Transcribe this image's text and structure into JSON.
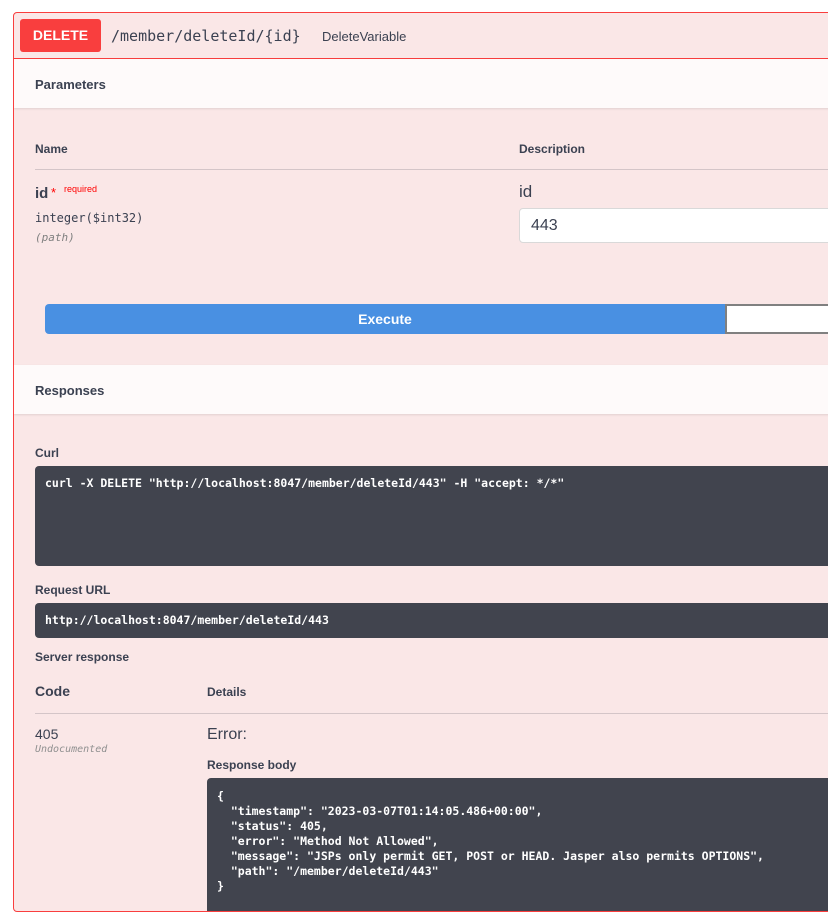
{
  "operation": {
    "method": "DELETE",
    "path": "/member/deleteId/{id}",
    "summary": "DeleteVariable"
  },
  "parameters": {
    "title": "Parameters",
    "col_name": "Name",
    "col_description": "Description",
    "items": [
      {
        "name": "id",
        "required_mark": "*",
        "required_label": "required",
        "type": "integer($int32)",
        "in": "(path)",
        "description": "id",
        "value": "443"
      }
    ]
  },
  "actions": {
    "execute_label": "Execute",
    "clear_label": ""
  },
  "responses": {
    "title": "Responses",
    "curl_label": "Curl",
    "curl_command": "curl -X DELETE \"http://localhost:8047/member/deleteId/443\" -H \"accept: */*\"",
    "request_url_label": "Request URL",
    "request_url": "http://localhost:8047/member/deleteId/443",
    "server_response_label": "Server response",
    "col_code": "Code",
    "col_details": "Details",
    "status_code": "405",
    "status_note": "Undocumented",
    "error_title": "Error:",
    "response_body_label": "Response body",
    "response_body_lines": [
      "{",
      "  \"timestamp\": \"2023-03-07T01:14:05.486+00:00\",",
      "  \"status\": 405,",
      "  \"error\": \"Method Not Allowed\",",
      "  \"message\": \"JSPs only permit GET, POST or HEAD. Jasper also permits OPTIONS\",",
      "  \"path\": \"/member/deleteId/443\"",
      "}"
    ]
  },
  "colors": {
    "delete": "#f93e3e",
    "block_bg": "#fae7e7",
    "execute": "#4990e2",
    "code_bg": "#41444e"
  }
}
